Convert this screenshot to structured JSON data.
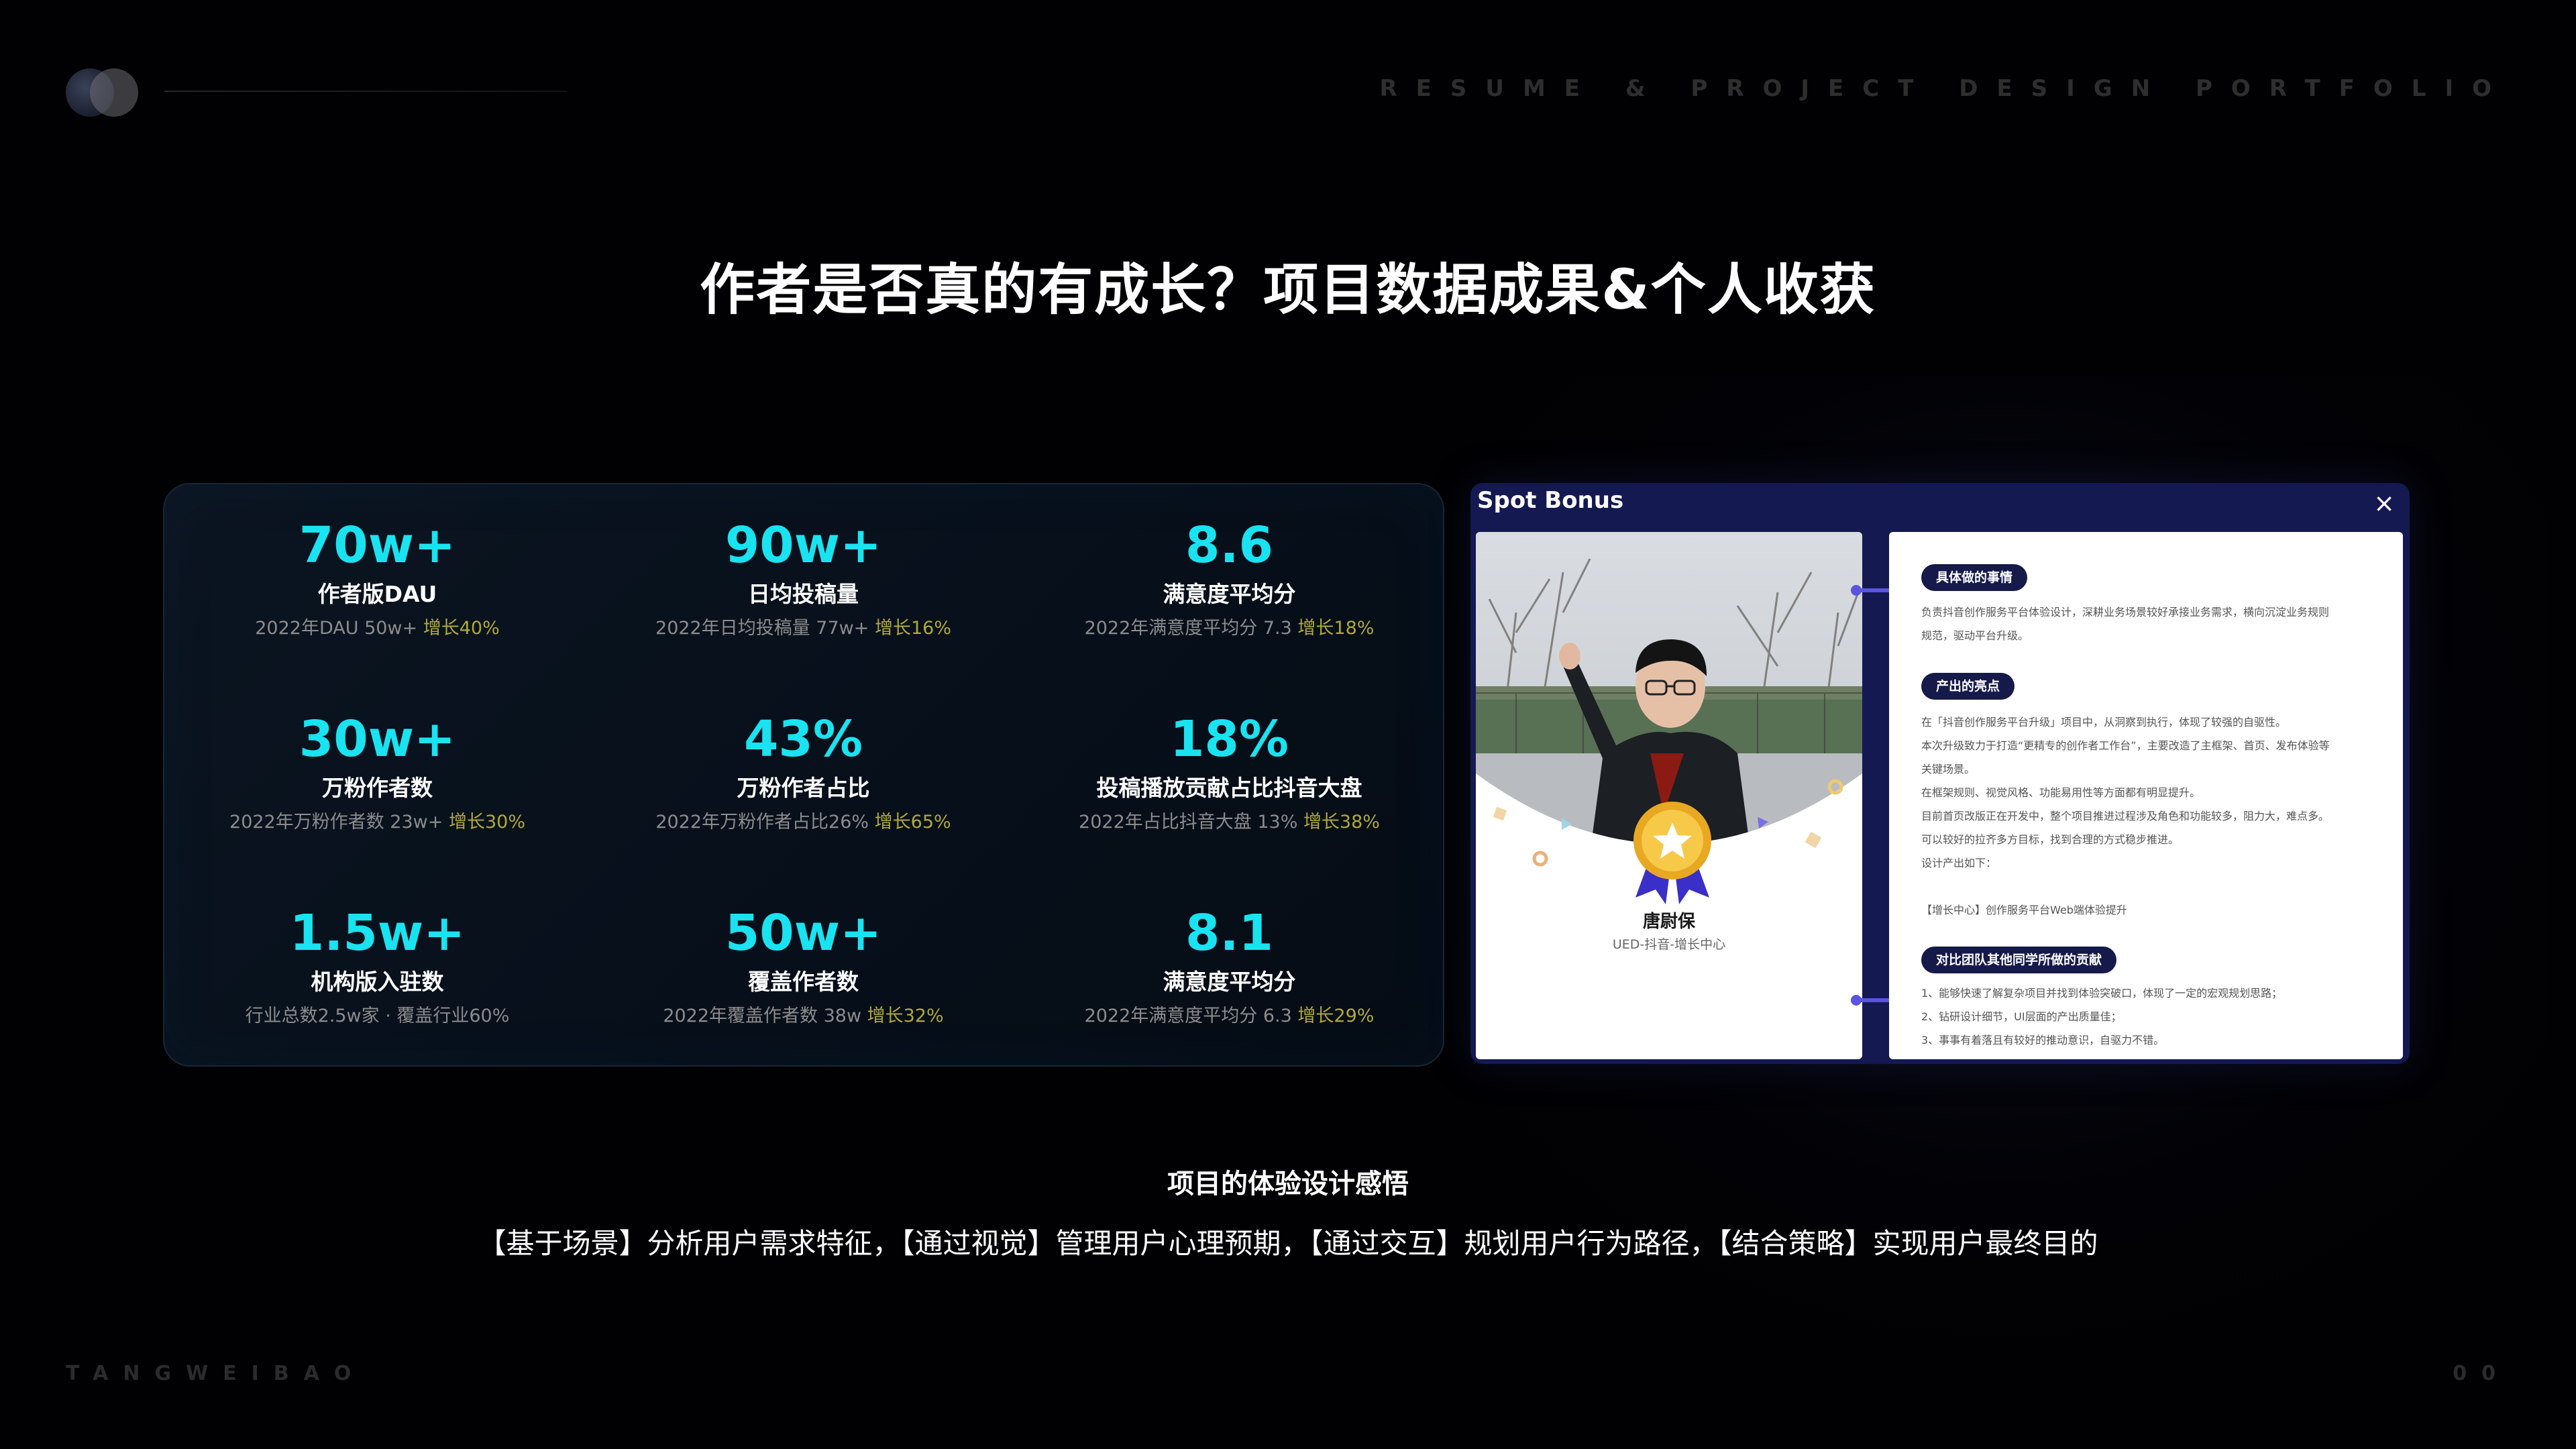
{
  "header": {
    "tagline": "RESUME & PROJECT DESIGN PORTFOLIO"
  },
  "title": "作者是否真的有成长？项目数据成果&个人收获",
  "stats": [
    {
      "value": "70w+",
      "label": "作者版DAU",
      "sub": "2022年DAU 50w+ ",
      "growth": "增长40%"
    },
    {
      "value": "90w+",
      "label": "日均投稿量",
      "sub": "2022年日均投稿量 77w+ ",
      "growth": "增长16%"
    },
    {
      "value": "8.6",
      "label": "满意度平均分",
      "sub": "2022年满意度平均分 7.3 ",
      "growth": "增长18%"
    },
    {
      "value": "30w+",
      "label": "万粉作者数",
      "sub": "2022年万粉作者数 23w+ ",
      "growth": "增长30%"
    },
    {
      "value": "43%",
      "label": "万粉作者占比",
      "sub": "2022年万粉作者占比26% ",
      "growth": "增长65%"
    },
    {
      "value": "18%",
      "label": "投稿播放贡献占比抖音大盘",
      "sub": "2022年占比抖音大盘 13% ",
      "growth": "增长38%"
    },
    {
      "value": "1.5w+",
      "label": "机构版入驻数",
      "sub": "行业总数2.5w家 · 覆盖行业60%",
      "growth": ""
    },
    {
      "value": "50w+",
      "label": "覆盖作者数",
      "sub": "2022年覆盖作者数 38w ",
      "growth": "增长32%"
    },
    {
      "value": "8.1",
      "label": "满意度平均分",
      "sub": "2022年满意度平均分 6.3 ",
      "growth": "增长29%"
    }
  ],
  "bonus": {
    "title": "Spot Bonus",
    "close_icon": "×",
    "person_name": "唐尉保",
    "person_dept": "UED-抖音-增长中心",
    "sections": [
      {
        "heading": "具体做的事情",
        "lines": [
          "负责抖音创作服务平台体验设计，深耕业务场景较好承接业务需求，横向沉淀业务规则",
          "规范，驱动平台升级。"
        ]
      },
      {
        "heading": "产出的亮点",
        "lines": [
          "在「抖音创作服务平台升级」项目中，从洞察到执行，体现了较强的自驱性。",
          "本次升级致力于打造“更精专的创作者工作台”，主要改造了主框架、首页、发布体验等",
          "关键场景。",
          "在框架规则、视觉风格、功能易用性等方面都有明显提升。",
          "目前首页改版正在开发中，整个项目推进过程涉及角色和功能较多，阻力大，难点多。",
          "可以较好的拉齐多方目标，找到合理的方式稳步推进。",
          "设计产出如下：",
          "",
          "【增长中心】创作服务平台Web端体验提升"
        ]
      },
      {
        "heading": "对比团队其他同学所做的贡献",
        "lines": [
          "1、能够快速了解复杂项目并找到体验突破口，体现了一定的宏观规划思路；",
          "2、钻研设计细节，UI层面的产出质量佳；",
          "3、事事有着落且有较好的推动意识，自驱力不错。"
        ]
      }
    ]
  },
  "reflection": {
    "title": "项目的体验设计感悟",
    "text": "【基于场景】分析用户需求特征，【通过视觉】管理用户心理预期，【通过交互】规划用户行为路径，【结合策略】实现用户最终目的"
  },
  "footer": {
    "author": "TANGWEIBAO",
    "page": "00"
  },
  "colors": {
    "accent_cyan": "#19e3f0",
    "growth_olive": "#b2a935",
    "panel_navy": "#141951",
    "connector_purple": "#5a54e0"
  }
}
